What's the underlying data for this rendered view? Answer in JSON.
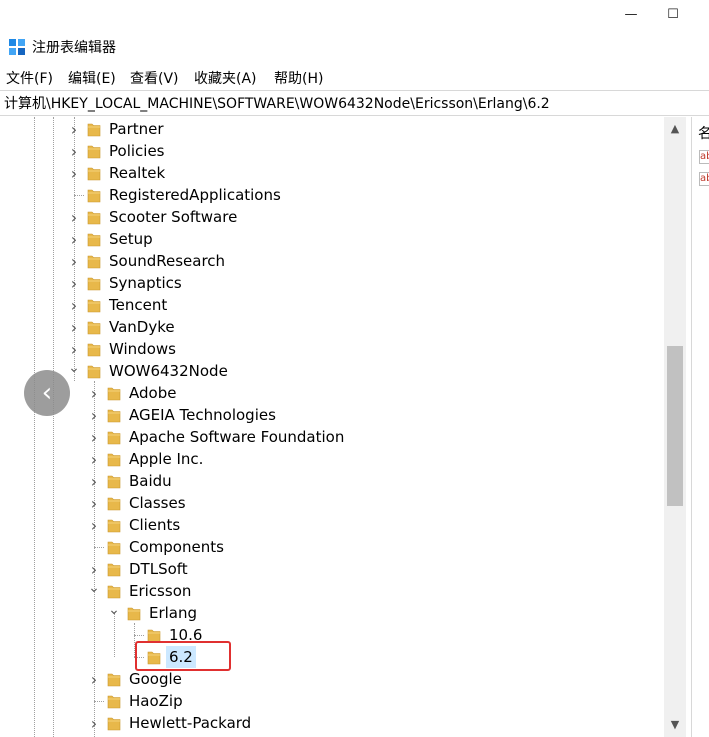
{
  "window": {
    "title": "注册表编辑器",
    "minimize_glyph": "—",
    "maximize_glyph": "☐"
  },
  "menu": [
    {
      "label": "文件(F)"
    },
    {
      "label": "编辑(E)"
    },
    {
      "label": "查看(V)"
    },
    {
      "label": "收藏夹(A)"
    },
    {
      "label": "帮助(H)"
    }
  ],
  "address": "计算机\\HKEY_LOCAL_MACHINE\\SOFTWARE\\WOW6432Node\\Ericsson\\Erlang\\6.2",
  "tree": [
    {
      "label": "Partner",
      "level": 0,
      "expander": "collapsed"
    },
    {
      "label": "Policies",
      "level": 0,
      "expander": "collapsed"
    },
    {
      "label": "Realtek",
      "level": 0,
      "expander": "collapsed"
    },
    {
      "label": "RegisteredApplications",
      "level": 0,
      "expander": "none"
    },
    {
      "label": "Scooter Software",
      "level": 0,
      "expander": "collapsed"
    },
    {
      "label": "Setup",
      "level": 0,
      "expander": "collapsed"
    },
    {
      "label": "SoundResearch",
      "level": 0,
      "expander": "collapsed"
    },
    {
      "label": "Synaptics",
      "level": 0,
      "expander": "collapsed"
    },
    {
      "label": "Tencent",
      "level": 0,
      "expander": "collapsed"
    },
    {
      "label": "VanDyke",
      "level": 0,
      "expander": "collapsed"
    },
    {
      "label": "Windows",
      "level": 0,
      "expander": "collapsed"
    },
    {
      "label": "WOW6432Node",
      "level": 0,
      "expander": "expanded"
    },
    {
      "label": "Adobe",
      "level": 1,
      "expander": "collapsed"
    },
    {
      "label": "AGEIA Technologies",
      "level": 1,
      "expander": "collapsed"
    },
    {
      "label": "Apache Software Foundation",
      "level": 1,
      "expander": "collapsed"
    },
    {
      "label": "Apple Inc.",
      "level": 1,
      "expander": "collapsed"
    },
    {
      "label": "Baidu",
      "level": 1,
      "expander": "collapsed"
    },
    {
      "label": "Classes",
      "level": 1,
      "expander": "collapsed"
    },
    {
      "label": "Clients",
      "level": 1,
      "expander": "collapsed"
    },
    {
      "label": "Components",
      "level": 1,
      "expander": "none"
    },
    {
      "label": "DTLSoft",
      "level": 1,
      "expander": "collapsed"
    },
    {
      "label": "Ericsson",
      "level": 1,
      "expander": "expanded"
    },
    {
      "label": "Erlang",
      "level": 2,
      "expander": "expanded"
    },
    {
      "label": "10.6",
      "level": 3,
      "expander": "none"
    },
    {
      "label": "6.2",
      "level": 3,
      "expander": "none",
      "selected": true
    },
    {
      "label": "Google",
      "level": 1,
      "expander": "collapsed"
    },
    {
      "label": "HaoZip",
      "level": 1,
      "expander": "none"
    },
    {
      "label": "Hewlett-Packard",
      "level": 1,
      "expander": "collapsed"
    }
  ],
  "right_pane": {
    "header_fragment": "名",
    "value_icon": "ab"
  },
  "colors": {
    "selection": "#cce8ff",
    "highlight_box": "#e03030",
    "folder": "#e8b84a"
  },
  "icons": {
    "back": "chevron-left-icon"
  }
}
